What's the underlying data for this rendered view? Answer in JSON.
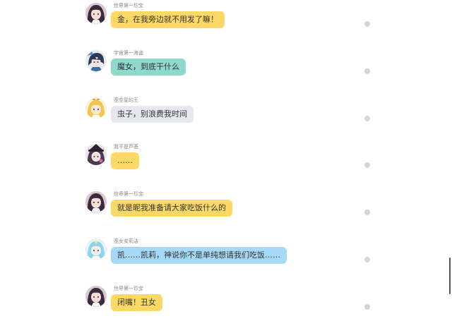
{
  "colors": {
    "yellow_bubble": "#fcd866",
    "teal_bubble": "#8fd9cc",
    "gray_bubble": "#e5e8ef",
    "blue_bubble": "#a6d9f5",
    "status_dot": "#d5d5d5"
  },
  "messages": [
    {
      "sender": "世界第一珍宝",
      "text": "金，在我旁边就不用发了嘛！",
      "bubble_color": "#fcd866",
      "avatar_icon": "dark-hair-girl-avatar"
    },
    {
      "sender": "宇宙第一海盗",
      "text": "魔女，到底干什么",
      "bubble_color": "#8fd9cc",
      "avatar_icon": "pirate-boy-avatar"
    },
    {
      "sender": "圣空星的王",
      "text": "虫子，别浪费我时间",
      "bubble_color": "#e5e8ef",
      "avatar_icon": "blonde-king-avatar"
    },
    {
      "sender": "我不是芦荟",
      "text": "……",
      "bubble_color": "#fcd866",
      "avatar_icon": "witch-girl-avatar"
    },
    {
      "sender": "世界第一珍宝",
      "text": "就是昵我准备请大家吃饭什么的",
      "bubble_color": "#fcd866",
      "avatar_icon": "dark-hair-girl-avatar"
    },
    {
      "sender": "圣女安莉洁",
      "text": "凯……凯莉，神说你不是单纯想请我们吃饭……",
      "bubble_color": "#a6d9f5",
      "avatar_icon": "blue-hair-saint-avatar"
    },
    {
      "sender": "世界第一珍宝",
      "text": "闭嘴！丑女",
      "bubble_color": "#fcd866",
      "avatar_icon": "dark-hair-girl-avatar"
    }
  ]
}
